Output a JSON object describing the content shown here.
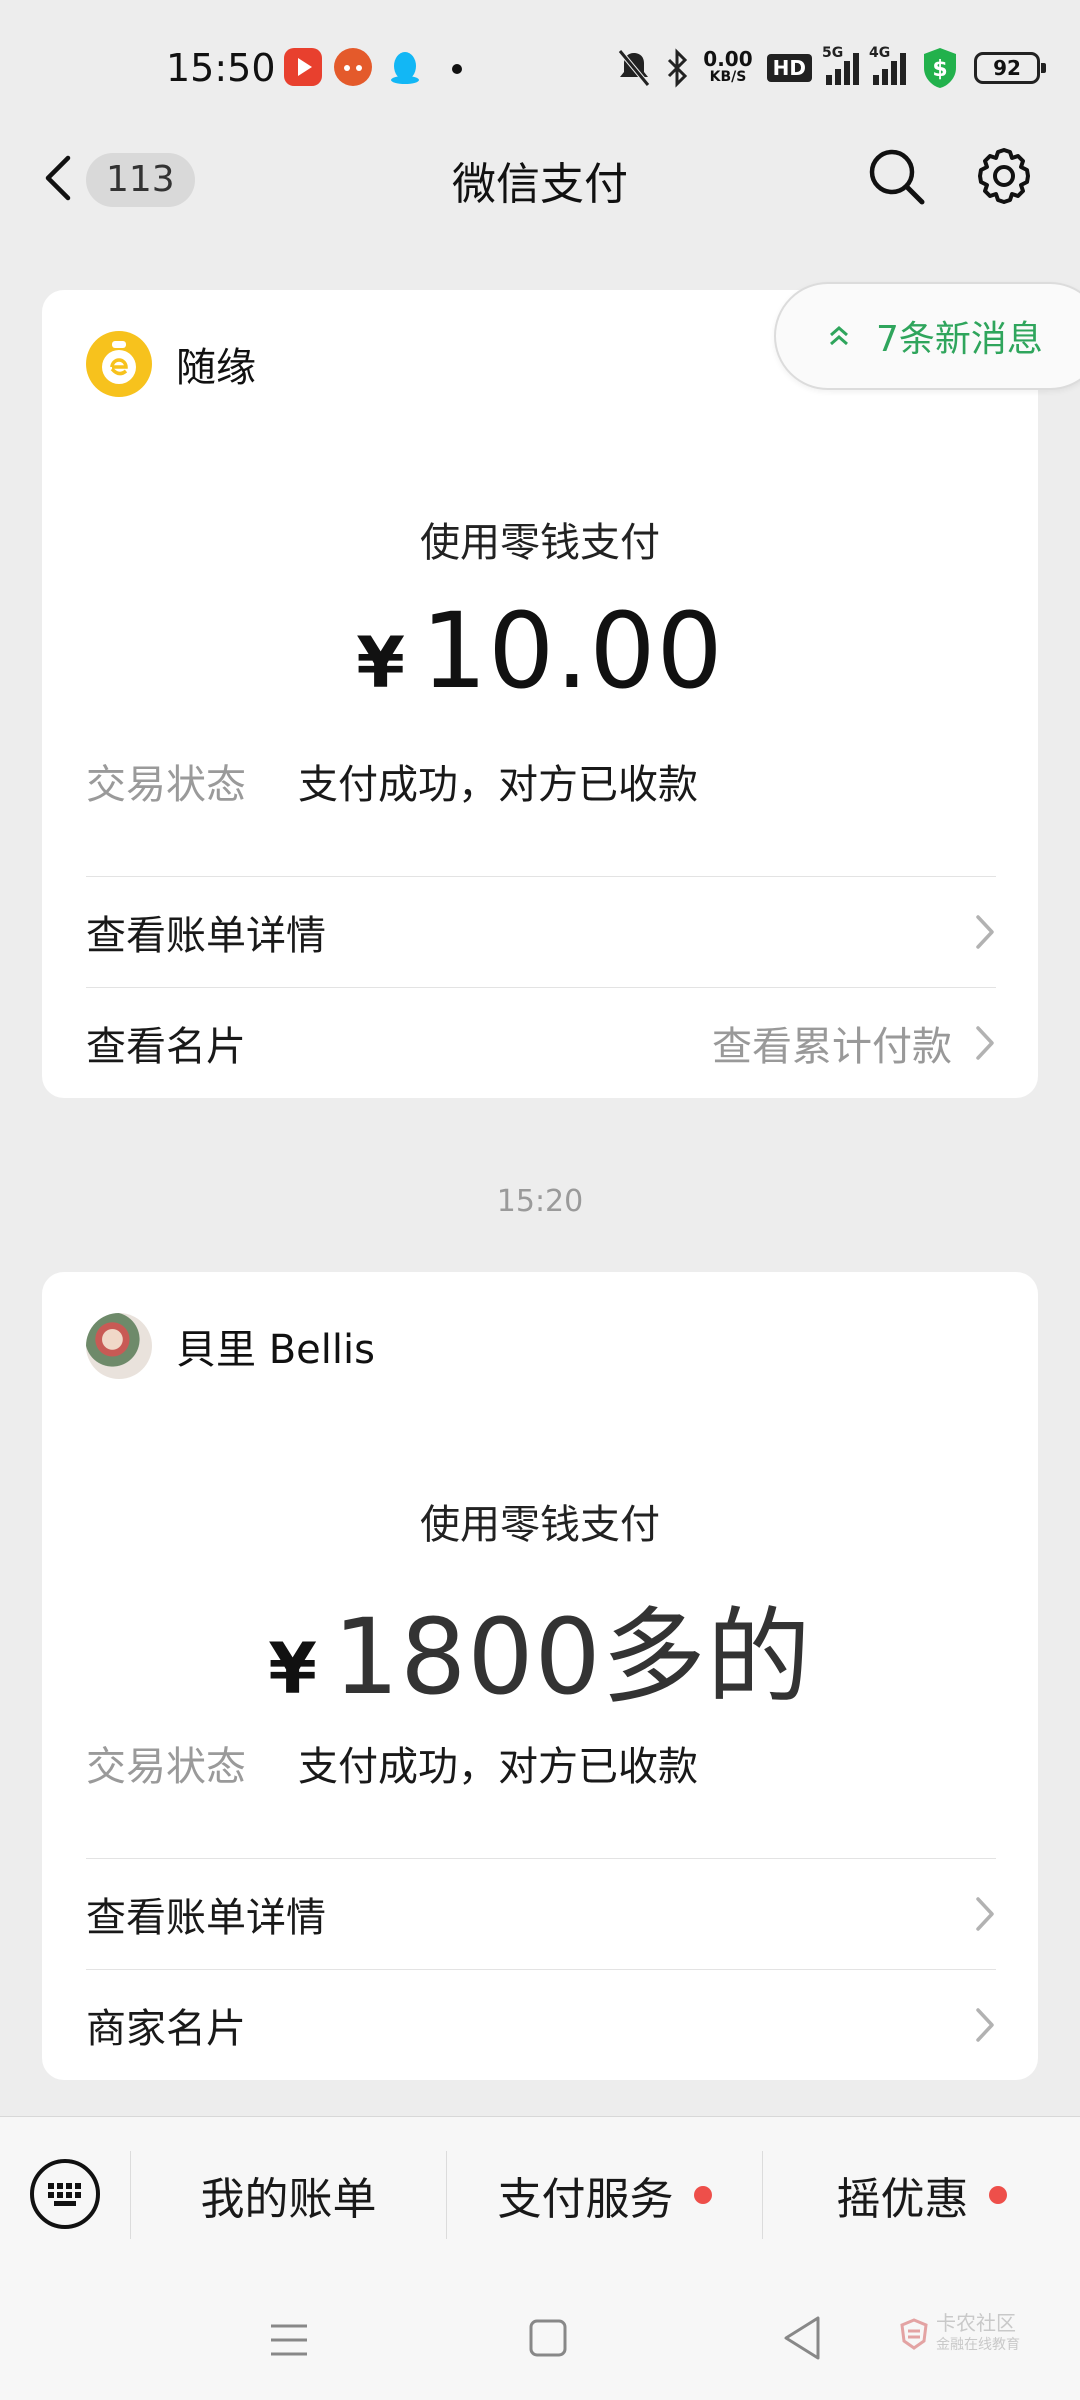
{
  "status_bar": {
    "time": "15:50",
    "network_speed": "0.00",
    "network_speed_unit": "KB/S",
    "hd_badge": "HD",
    "signal1_label": "5G",
    "signal2_label": "4G",
    "battery": "92",
    "app_icons": [
      "video-app-icon",
      "chat-app-icon",
      "qq-icon"
    ]
  },
  "nav": {
    "unread_count": "113",
    "title": "微信支付"
  },
  "new_messages": "7条新消息",
  "cards": [
    {
      "merchant": "随缘",
      "pay_method": "使用零钱支付",
      "currency": "¥",
      "amount": "10.00",
      "status_label": "交易状态",
      "status_value": "支付成功，对方已收款",
      "row1": "查看账单详情",
      "row2": "查看名片",
      "row2_right": "查看累计付款"
    },
    {
      "merchant": "貝里 Bellis",
      "pay_method": "使用零钱支付",
      "currency": "¥",
      "amount": "1800多的",
      "status_label": "交易状态",
      "status_value": "支付成功，对方已收款",
      "row1": "查看账单详情",
      "row2": "商家名片"
    }
  ],
  "timestamp": "15:20",
  "bottom_menu": {
    "items": [
      "我的账单",
      "支付服务",
      "摇优惠"
    ]
  },
  "watermark": {
    "line1": "卡农社区",
    "line2": "金融在线教育"
  },
  "colors": {
    "accent_green": "#2fa55c",
    "badge_red": "#ee4f4a",
    "background": "#ededed"
  }
}
